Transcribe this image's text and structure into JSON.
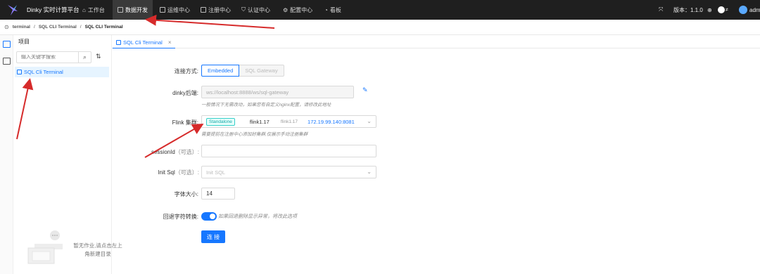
{
  "header": {
    "app_title": "Dinky 实时计算平台",
    "nav": [
      {
        "label": "工作台",
        "icon": "home-icon"
      },
      {
        "label": "数据开发",
        "icon": "code-icon",
        "active": true
      },
      {
        "label": "运维中心",
        "icon": "monitor-icon"
      },
      {
        "label": "注册中心",
        "icon": "database-icon"
      },
      {
        "label": "认证中心",
        "icon": "shield-icon"
      },
      {
        "label": "配置中心",
        "icon": "gear-icon"
      },
      {
        "label": "看板",
        "icon": "dashboard-icon"
      }
    ],
    "version": "版本：1.1.0",
    "user": "adm"
  },
  "breadcrumb": {
    "items": [
      "terminal",
      "/",
      "SQL CLI Terminal",
      "/",
      "SQL CLI Terminal"
    ]
  },
  "project_panel": {
    "title": "项目",
    "search_placeholder": "输入关键字搜索",
    "tree_item": "SQL Cli Terminal",
    "empty_text": "暂无作业,请点击左上角新建目录"
  },
  "tab": {
    "label": "SQL Cli Terminal",
    "close": "×"
  },
  "form": {
    "connect_mode_label": "连接方式:",
    "mode_embedded": "Embedded",
    "mode_gateway": "SQL Gateway",
    "backend_label": "dinky后端:",
    "backend_value": "ws://localhost:8888/ws/sql-gateway",
    "backend_hint": "一般情况下无需改动，如果您有自定义nginx配置，请修改此地址",
    "cluster_label": "Flink 集群:",
    "cluster_type": "Standalone",
    "cluster_name": "flink1.17",
    "cluster_alias": "flink1.17",
    "cluster_address": "172.19.99.140:8081",
    "cluster_hint": "需要提前在注册中心添加好集群,仅展示手动注册集群",
    "session_label": "sessionId",
    "session_optional": "（可选）:",
    "init_label": "Init Sql",
    "init_optional": "（可选）:",
    "init_placeholder": "Init SQL",
    "font_label": "字体大小:",
    "font_value": "14",
    "backspace_label": "回退字符转换:",
    "backspace_hint": "如果回退删除显示异常，将改此选项",
    "connect_button": "连 接"
  },
  "colors": {
    "accent": "#1677ff",
    "topbar": "#1f1f1f",
    "annotation_arrow": "#d62b2b"
  }
}
